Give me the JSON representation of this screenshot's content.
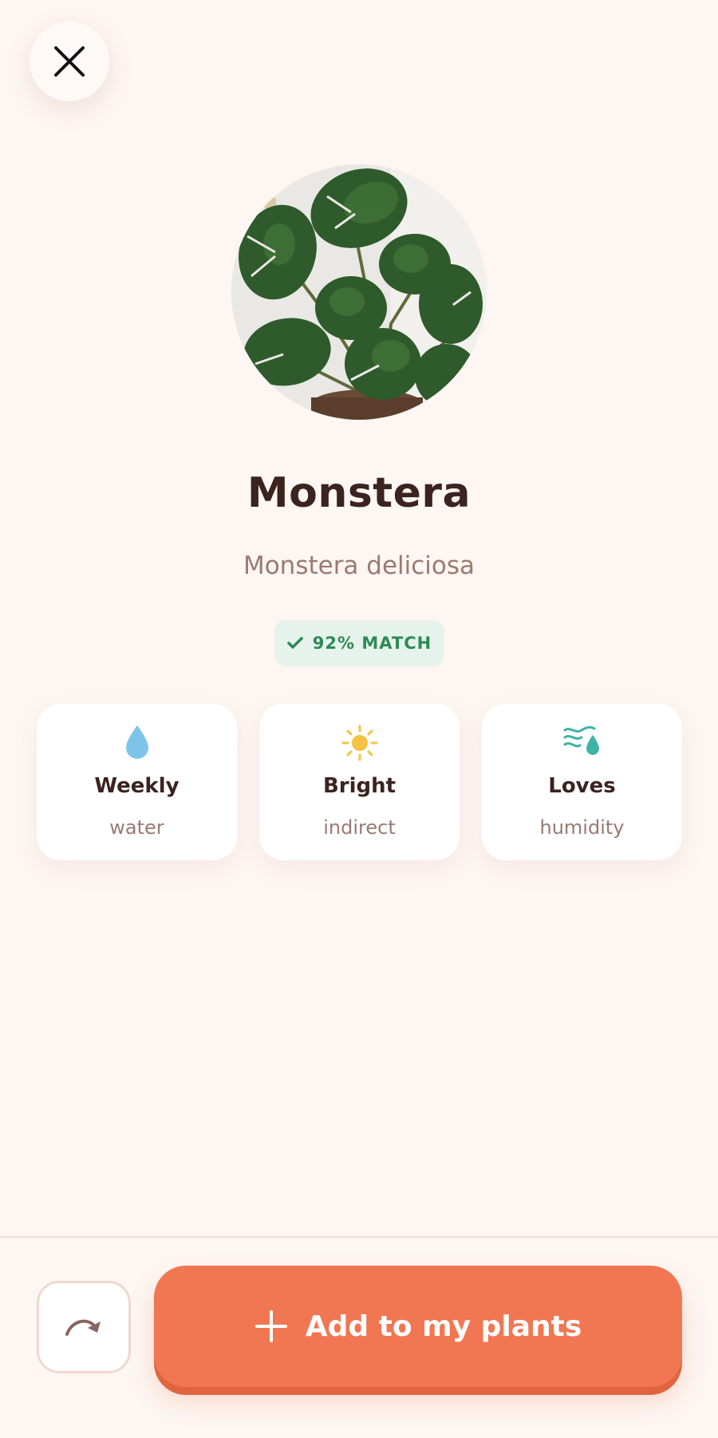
{
  "plant": {
    "name": "Monstera",
    "latin_name": "Monstera deliciosa",
    "match_label": "92% MATCH"
  },
  "care_cards": [
    {
      "icon": "water-drop-icon",
      "title": "Weekly",
      "subtitle": "water"
    },
    {
      "icon": "sun-icon",
      "title": "Bright",
      "subtitle": "indirect"
    },
    {
      "icon": "humidity-icon",
      "title": "Loves",
      "subtitle": "humidity"
    }
  ],
  "actions": {
    "add_label": "Add to my plants"
  },
  "colors": {
    "background": "#fdf6f2",
    "accent": "#f07752",
    "match_green": "#2e8a55",
    "water_blue": "#7ec4ea",
    "sun_yellow": "#f6c243",
    "humidity_teal": "#3fb3a7"
  }
}
